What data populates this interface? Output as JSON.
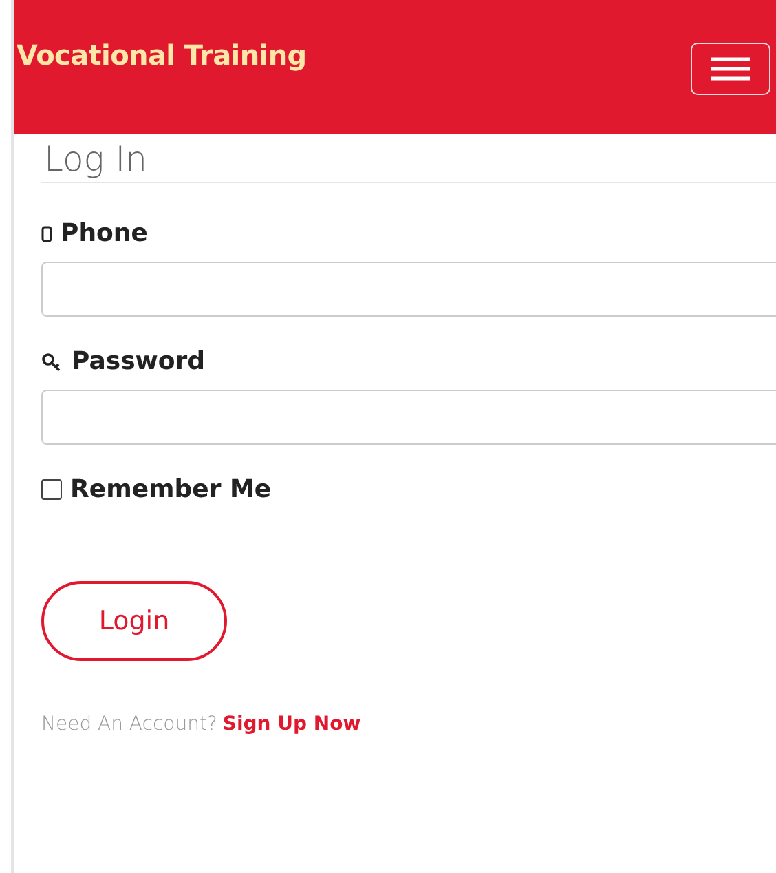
{
  "header": {
    "brand": "Vocational Training"
  },
  "form": {
    "title": "Log In",
    "fields": [
      {
        "kind": "phone",
        "label": "Phone"
      },
      {
        "kind": "password",
        "label": "Password"
      }
    ],
    "remember": {
      "label": "Remember Me",
      "checked": false
    },
    "submit": "Login",
    "footer": {
      "prompt": "Need An Account?",
      "link": "Sign Up Now"
    }
  }
}
